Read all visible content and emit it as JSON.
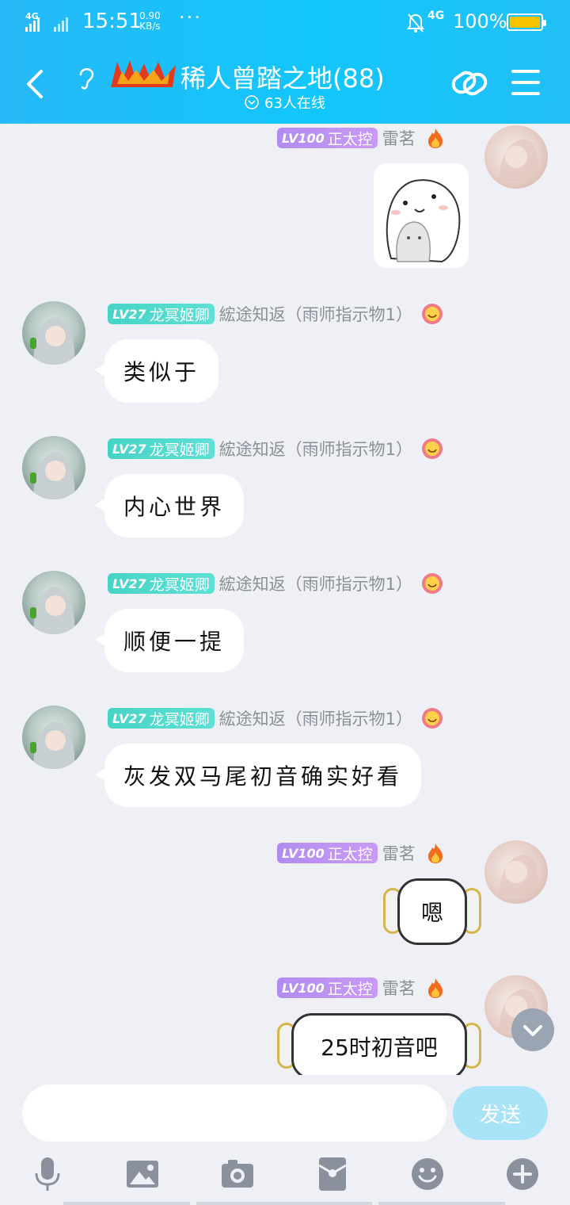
{
  "status_bar": {
    "network_left": "4G",
    "time": "15:51",
    "speed_value": "0.90",
    "speed_unit": "KB/s",
    "dots": "···",
    "network_right": "4G",
    "battery": "100%",
    "battery_color": "#f9c300"
  },
  "header": {
    "title": "稀人曾踏之地",
    "member_count": "(88)",
    "online": "63人在线",
    "back_icon": "chevron-left-icon",
    "ear_icon": "ear-icon",
    "link_icon": "link-icon",
    "menu_icon": "menu-icon"
  },
  "messages": [
    {
      "side": "right",
      "level": "LV100",
      "title": "正太控",
      "name": "雷茗",
      "type": "sticker"
    },
    {
      "side": "left",
      "level": "LV27",
      "title": "龙冥姬卿",
      "name": "綋途知返（雨师指示物1）",
      "text": "类似于"
    },
    {
      "side": "left",
      "level": "LV27",
      "title": "龙冥姬卿",
      "name": "綋途知返（雨师指示物1）",
      "text": "内心世界"
    },
    {
      "side": "left",
      "level": "LV27",
      "title": "龙冥姬卿",
      "name": "綋途知返（雨师指示物1）",
      "text": "顺便一提"
    },
    {
      "side": "left",
      "level": "LV27",
      "title": "龙冥姬卿",
      "name": "綋途知返（雨师指示物1）",
      "text": "灰发双马尾初音确实好看"
    },
    {
      "side": "right",
      "level": "LV100",
      "title": "正太控",
      "name": "雷茗",
      "text": "嗯"
    },
    {
      "side": "right",
      "level": "LV100",
      "title": "正太控",
      "name": "雷茗",
      "text": "25时初音吧"
    }
  ],
  "input": {
    "placeholder": "",
    "send_label": "发送"
  },
  "toolbar": [
    "microphone-icon",
    "image-icon",
    "camera-icon",
    "red-packet-icon",
    "emoji-icon",
    "plus-icon"
  ],
  "colors": {
    "header_accent": "#12c6fb",
    "lv_purple": "#b18cf0",
    "lv_teal": "#45d4c6",
    "send_button": "#a8e3f7"
  }
}
